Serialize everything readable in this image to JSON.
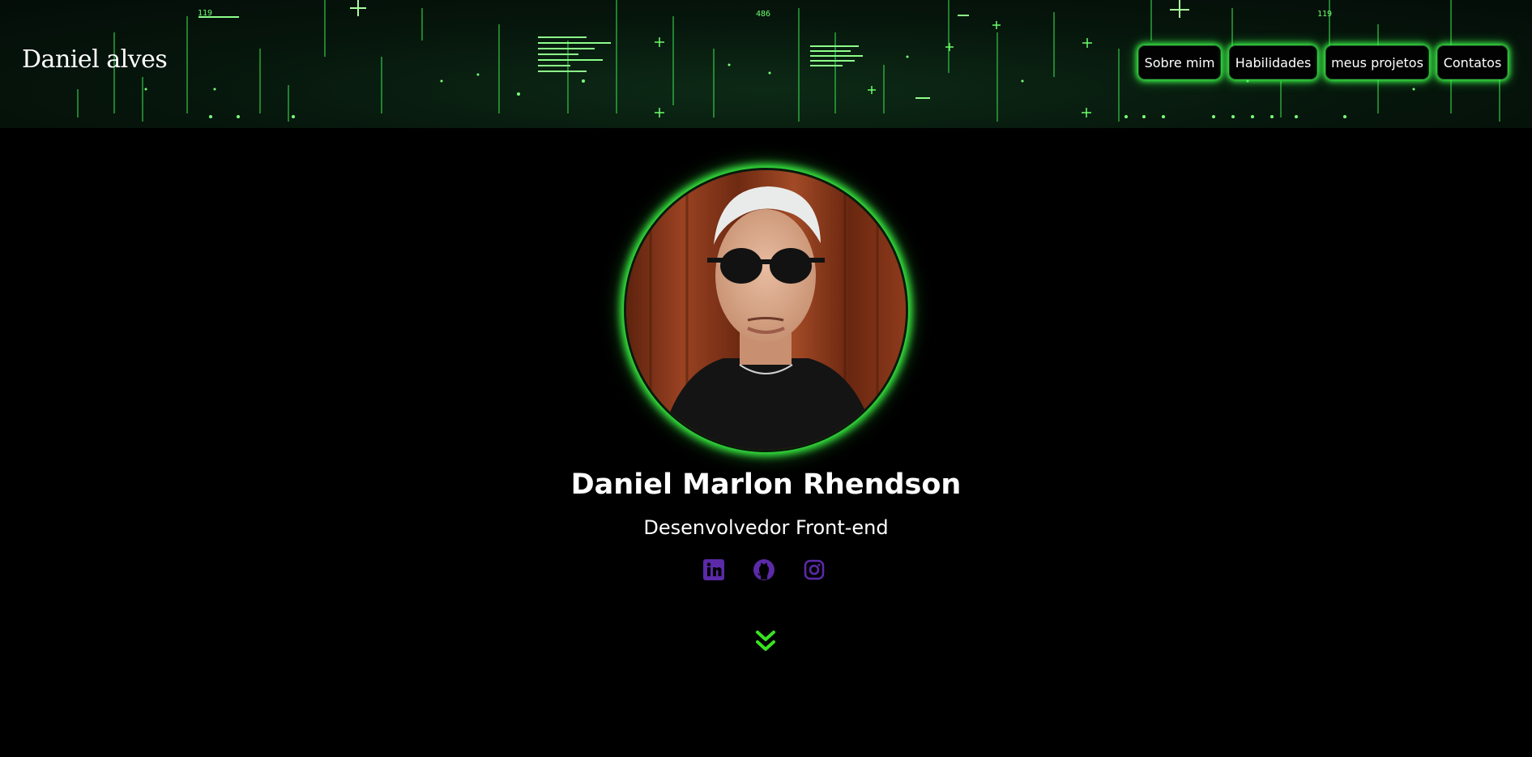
{
  "header": {
    "logo_text": "Daniel alves",
    "nav": [
      {
        "label": "Sobre mim"
      },
      {
        "label": "Habilidades"
      },
      {
        "label": "meus projetos"
      },
      {
        "label": "Contatos"
      }
    ]
  },
  "hero": {
    "name": "Daniel Marlon Rhendson",
    "role": "Desenvolvedor Front-end",
    "socials": [
      {
        "icon": "linkedin-icon",
        "color": "#5b2aa8"
      },
      {
        "icon": "github-icon",
        "color": "#5b2aa8"
      },
      {
        "icon": "instagram-icon",
        "color": "#5b2aa8"
      }
    ],
    "scroll_icon": "double-chevron-down-icon",
    "scroll_color": "#37e321"
  },
  "colors": {
    "background": "#000000",
    "glow": "#3cff46",
    "accent_purple": "#5b2aa8"
  }
}
